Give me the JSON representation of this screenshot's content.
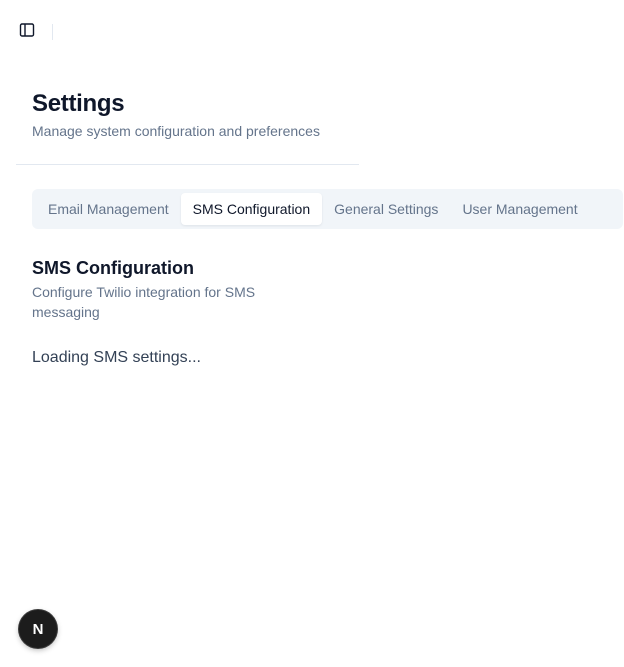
{
  "topbar": {
    "sidebar_toggle_icon": "panel-left-icon"
  },
  "header": {
    "title": "Settings",
    "subtitle": "Manage system configuration and preferences"
  },
  "tabs": [
    {
      "label": "Email Management",
      "active": false
    },
    {
      "label": "SMS Configuration",
      "active": true
    },
    {
      "label": "General Settings",
      "active": false
    },
    {
      "label": "User Management",
      "active": false
    }
  ],
  "section": {
    "title": "SMS Configuration",
    "description": "Configure Twilio integration for SMS messaging"
  },
  "status": {
    "loading_text": "Loading SMS settings..."
  },
  "dev_badge": {
    "letter": "N"
  },
  "colors": {
    "text_primary": "#0f172a",
    "text_muted": "#64748b",
    "tab_track": "#f1f5f9",
    "border": "#e2e8f0",
    "badge_bg": "#1c1c1c"
  }
}
